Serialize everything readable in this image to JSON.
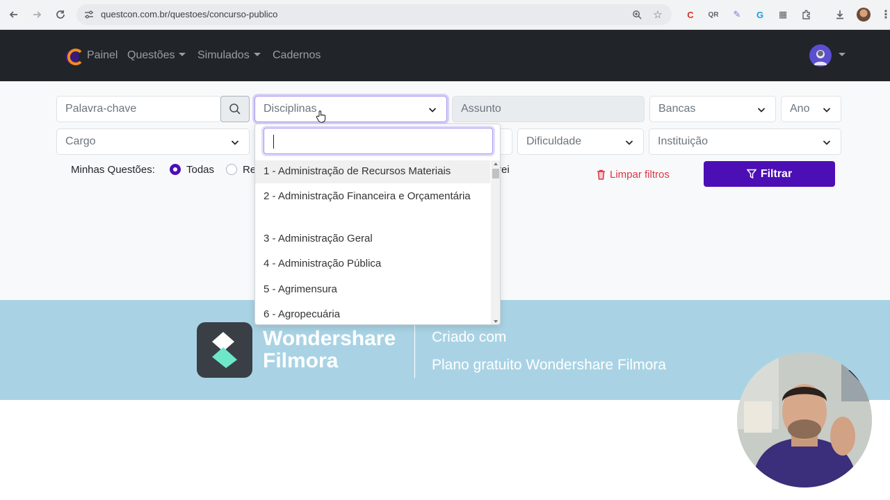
{
  "browser": {
    "url": "questcon.com.br/questoes/concurso-publico",
    "extensions": [
      "C",
      "QR",
      "✎",
      "G",
      "▦"
    ]
  },
  "navbar": {
    "brand_label": "Painel",
    "links": [
      {
        "label": "Questões",
        "has_dropdown": true
      },
      {
        "label": "Simulados",
        "has_dropdown": true
      },
      {
        "label": "Cadernos",
        "has_dropdown": false
      }
    ]
  },
  "filters": {
    "keyword_placeholder": "Palavra-chave",
    "disciplinas": "Disciplinas",
    "assunto": "Assunto",
    "bancas": "Bancas",
    "ano": "Ano",
    "cargo": "Cargo",
    "dificuldade": "Dificuldade",
    "instituicao": "Instituição",
    "minhas_questoes_label": "Minhas Questões:",
    "radio_todas": "Todas",
    "radio_partial_left": "Re",
    "radio_partial_right": "rei",
    "limpar_label": "Limpar filtros",
    "filtrar_label": "Filtrar"
  },
  "dropdown": {
    "items": [
      "1 - Administração de Recursos Materiais",
      "2 - Administração Financeira e Orçamentária",
      "3 - Administração Geral",
      "4 - Administração Pública",
      "5 - Agrimensura",
      "6 - Agropecuária"
    ]
  },
  "watermark": {
    "brand_line1": "Wondershare",
    "brand_line2": "Filmora",
    "line1": "Criado com",
    "line2": "Plano gratuito Wondershare Filmora"
  },
  "colors": {
    "accent": "#4c0fb5",
    "danger": "#dc3545",
    "navbar_bg": "#212529",
    "banner_bg": "#a9d3e4"
  }
}
